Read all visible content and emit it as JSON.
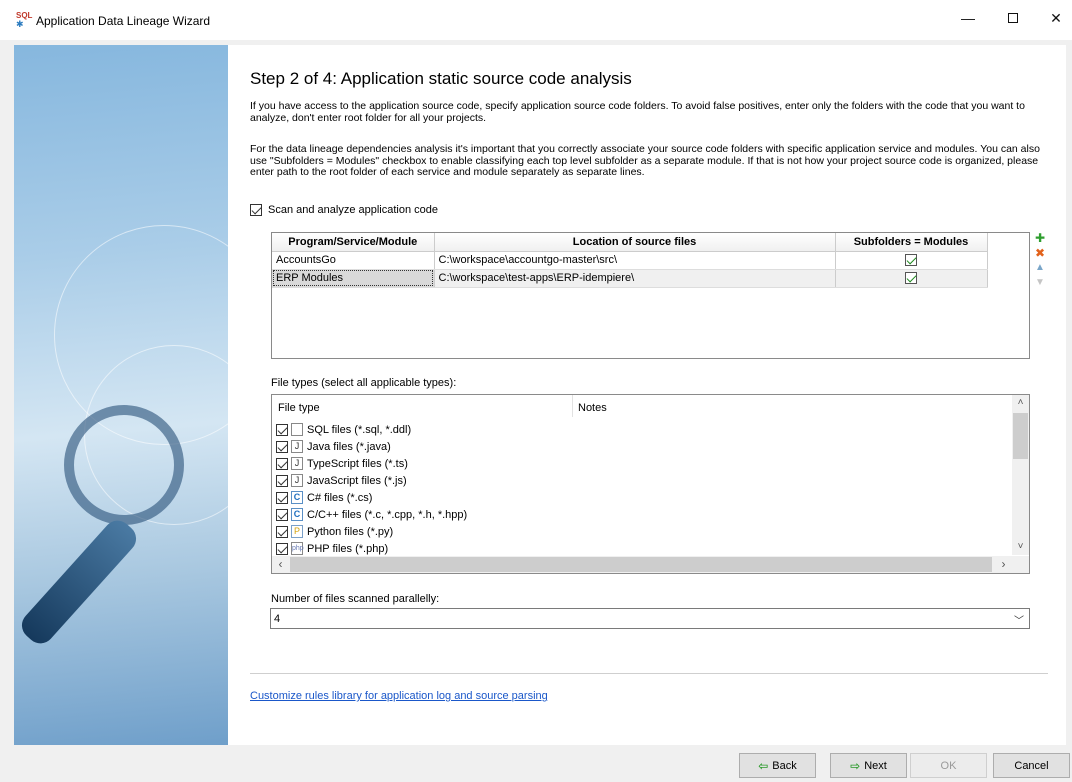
{
  "window": {
    "title": "Application Data Lineage Wizard",
    "app_icon_text": "SQL",
    "minimize": "—",
    "close": "✕"
  },
  "step": {
    "title": "Step 2 of 4:  Application static source code analysis",
    "para1": "If you have access to the application source code, specify application source code folders. To avoid false positives, enter only the folders with the code that you want to analyze, don't enter root folder for all your projects.",
    "para2": "For the data lineage dependencies analysis it's important that you correctly associate your source code folders with specific application service and modules. You can also use \"Subfolders = Modules\" checkbox to enable classifying each top level subfolder as a separate module. If that is not how your project source code is organized, please enter path to the root folder of each service and module separately as separate lines."
  },
  "scan_checkbox": {
    "label": "Scan and analyze application code",
    "checked": true
  },
  "source_grid": {
    "columns": [
      "Program/Service/Module",
      "Location of source files",
      "Subfolders = Modules"
    ],
    "rows": [
      {
        "module": "AccountsGo",
        "location": "C:\\workspace\\accountgo-master\\src\\",
        "subfolders": true
      },
      {
        "module": "ERP Modules",
        "location": "C:\\workspace\\test-apps\\ERP-idempiere\\",
        "subfolders": true
      }
    ]
  },
  "file_types": {
    "label": "File types (select all applicable types):",
    "columns": [
      "File type",
      "Notes"
    ],
    "items": [
      {
        "label": "SQL files (*.sql, *.ddl)",
        "icon": "sql-file-icon",
        "glyph": "",
        "checked": true
      },
      {
        "label": "Java files (*.java)",
        "icon": "java-file-icon",
        "glyph": "J",
        "checked": true
      },
      {
        "label": "TypeScript files (*.ts)",
        "icon": "typescript-file-icon",
        "glyph": "J",
        "checked": true
      },
      {
        "label": "JavaScript files (*.js)",
        "icon": "javascript-file-icon",
        "glyph": "J",
        "checked": true
      },
      {
        "label": "C# files (*.cs)",
        "icon": "csharp-file-icon",
        "glyph": "C",
        "checked": true
      },
      {
        "label": "C/C++ files (*.c, *.cpp, *.h, *.hpp)",
        "icon": "cpp-file-icon",
        "glyph": "C",
        "checked": true
      },
      {
        "label": "Python files (*.py)",
        "icon": "python-file-icon",
        "glyph": "P",
        "checked": true
      },
      {
        "label": "PHP files (*.php)",
        "icon": "php-file-icon",
        "glyph": "php",
        "checked": true
      }
    ]
  },
  "parallel": {
    "label": "Number of files scanned parallelly:",
    "value": "4"
  },
  "link": {
    "label": "Customize rules library for application log and source parsing"
  },
  "buttons": {
    "back": "Back",
    "next": "Next",
    "ok": "OK",
    "cancel": "Cancel"
  }
}
